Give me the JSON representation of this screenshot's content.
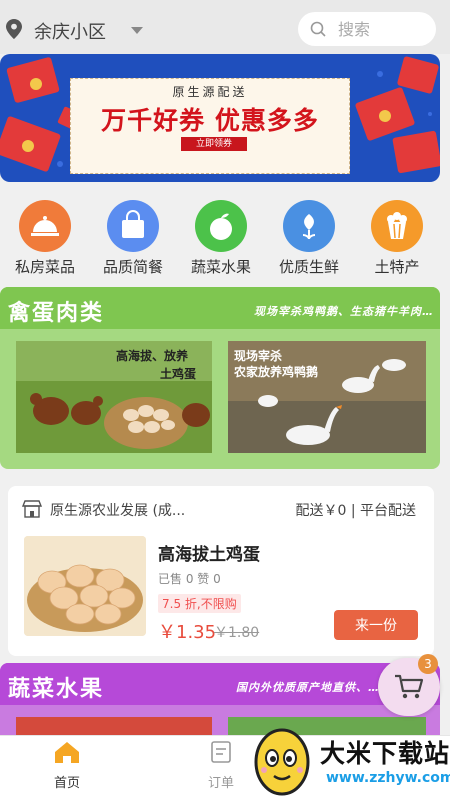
{
  "header": {
    "location": "余庆小区",
    "search_placeholder": "搜索"
  },
  "banner": {
    "subtitle": "原生源配送",
    "headline": "万千好券 优惠多多",
    "button": "立即领券"
  },
  "categories": [
    {
      "label": "私房菜品",
      "icon": "cloche-icon",
      "color": "#f07b3a"
    },
    {
      "label": "品质简餐",
      "icon": "bag-icon",
      "color": "#5b8df0"
    },
    {
      "label": "蔬菜水果",
      "icon": "apple-icon",
      "color": "#4cc24a"
    },
    {
      "label": "优质生鲜",
      "icon": "flower-icon",
      "color": "#4a90e2"
    },
    {
      "label": "土特产",
      "icon": "popcorn-icon",
      "color": "#f59a2a"
    }
  ],
  "section_poultry": {
    "title": "禽蛋肉类",
    "slogan": "现场宰杀鸡鸭鹅、生态猪牛羊肉…",
    "photos": [
      {
        "caption_line1": "高海拔、放养",
        "caption_line2": "土鸡蛋"
      },
      {
        "caption_line1": "现场宰杀",
        "caption_line2": "农家放养鸡鸭鹅"
      }
    ]
  },
  "product": {
    "shop_name": "原生源农业发展 (成...",
    "delivery": "配送￥0 | 平台配送",
    "title": "高海拔土鸡蛋",
    "stats": "已售 0   赞 0",
    "discount_tag": "7.5 折,不限购",
    "price": "￥1.35",
    "old_price": "￥1.80",
    "buy_button": "来一份"
  },
  "section_fruit": {
    "title": "蔬菜水果",
    "slogan": "国内外优质原产地直供、…"
  },
  "cart": {
    "badge": "3"
  },
  "tabbar": {
    "home": "首页",
    "orders": "订单"
  },
  "watermark": {
    "title": "大米下载站",
    "url": "www.zzhyw.com"
  },
  "colors": {
    "accent": "#e86442",
    "price": "#e84c3d",
    "home_tab": "#f5a623"
  }
}
